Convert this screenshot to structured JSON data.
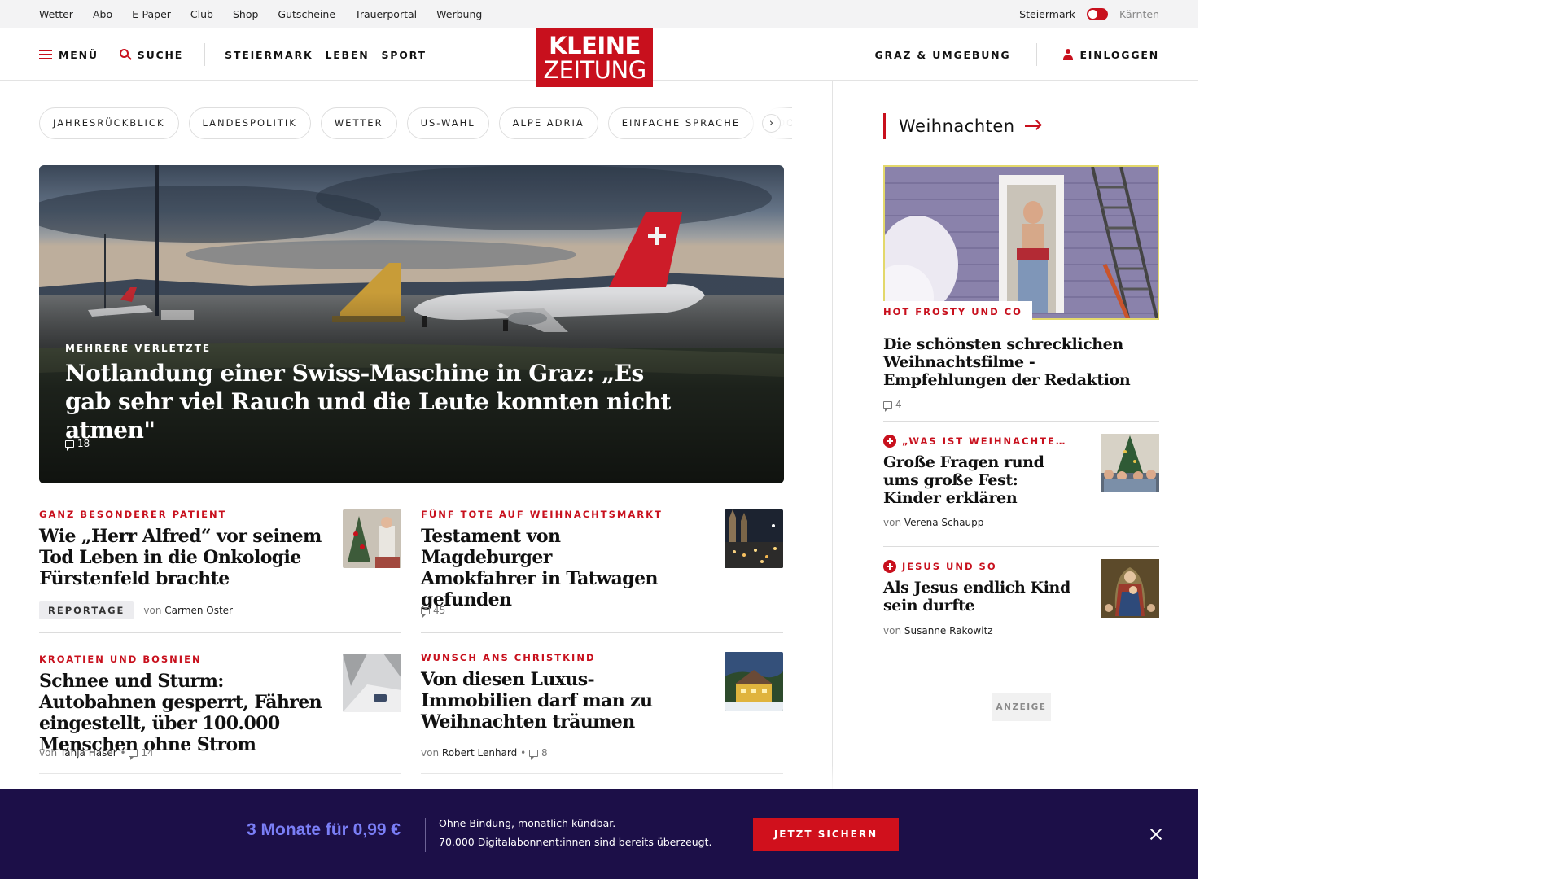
{
  "utility": {
    "links": [
      "Wetter",
      "Abo",
      "E-Paper",
      "Club",
      "Shop",
      "Gutscheine",
      "Trauerportal",
      "Werbung"
    ],
    "region_active": "Steiermark",
    "region_inactive": "Kärnten"
  },
  "header": {
    "menu_label": "MENÜ",
    "search_label": "SUCHE",
    "nav": [
      "STEIERMARK",
      "LEBEN",
      "SPORT"
    ],
    "logo_line1": "KLEINE",
    "logo_line2": "ZEITUNG",
    "region_link": "GRAZ & UMGEBUNG",
    "login_label": "EINLOGGEN"
  },
  "tags": [
    "JAHRESRÜCKBLICK",
    "LANDESPOLITIK",
    "WETTER",
    "US-WAHL",
    "ALPE ADRIA",
    "EINFACHE SPRACHE",
    "DO"
  ],
  "hero": {
    "kicker": "MEHRERE VERLETZTE",
    "title": "Notlandung einer Swiss-Maschine in Graz: „Es gab sehr viel Rauch und die Leute konnten nicht atmen\"",
    "comments": "18"
  },
  "articles": [
    {
      "kicker": "GANZ BESONDERER PATIENT",
      "title": "Wie „Herr Alfred“ vor seinem Tod Leben in die Onkologie Fürstenfeld brachte",
      "badge": "REPORTAGE",
      "by": "von",
      "author": "Carmen Oster"
    },
    {
      "kicker": "FÜNF TOTE AUF WEIHNACHTSMARKT",
      "title": "Testament von Magdeburger Amokfahrer in Tatwagen gefunden",
      "comments": "45"
    },
    {
      "kicker": "KROATIEN UND BOSNIEN",
      "title": "Schnee und Sturm: Autobahnen gesperrt, Fähren eingestellt, über 100.000 Menschen ohne Strom",
      "by": "von",
      "author": "Tanja Haser",
      "comments": "14"
    },
    {
      "kicker": "WUNSCH ANS CHRISTKIND",
      "title": "Von diesen Luxus-Immobilien darf man zu Weihnachten träumen",
      "by": "von",
      "author": "Robert Lenhard",
      "comments": "8"
    }
  ],
  "sidebar": {
    "heading": "Weihnachten",
    "feature": {
      "kicker": "HOT FROSTY UND CO",
      "title": "Die schönsten schrecklichen Weihnachtsfilme - Empfehlungen der Redaktion",
      "comments": "4"
    },
    "items": [
      {
        "kicker": "„WAS IST WEIHNACHTE…",
        "title": "Große Fragen rund ums große Fest: Kinder erklären",
        "by": "von",
        "author": "Verena Schaupp"
      },
      {
        "kicker": "JESUS UND SO",
        "title": "Als Jesus endlich Kind sein durfte",
        "by": "von",
        "author": "Susanne Rakowitz"
      }
    ],
    "ad_label": "ANZEIGE"
  },
  "promo": {
    "price": "3 Monate für 0,99 €",
    "line1": "Ohne Bindung, monatlich kündbar.",
    "line2": "70.000 Digitalabonnent:innen sind bereits überzeugt.",
    "cta": "JETZT SICHERN"
  },
  "colors": {
    "brand_red": "#c8101d",
    "promo_bg": "#1c0f48",
    "promo_price": "#7a7ef6"
  }
}
